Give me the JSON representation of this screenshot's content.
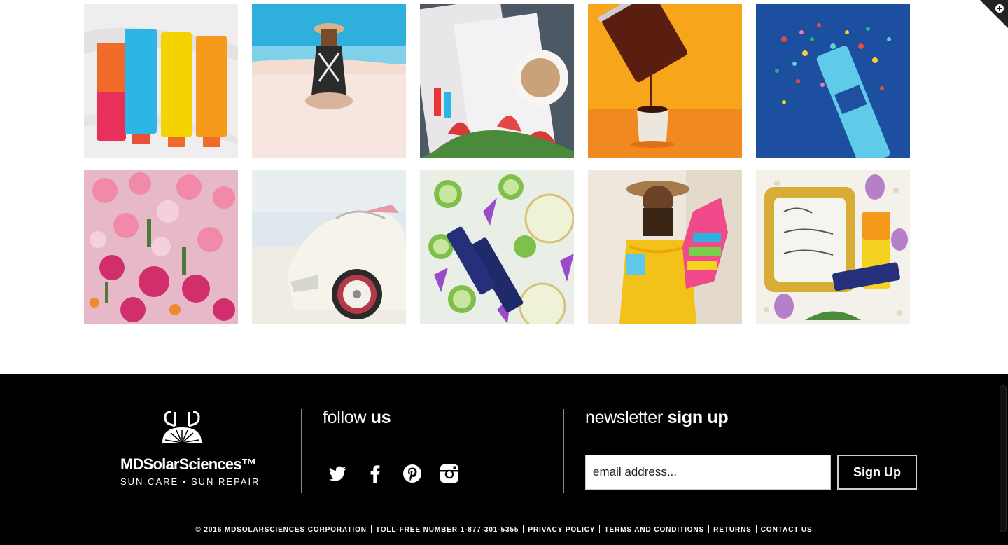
{
  "gallery": {
    "tiles": [
      {
        "subject": "sunscreen tubes on marble",
        "colors": [
          "#f2eeee",
          "#e8305a",
          "#2fb4e8",
          "#f4d400",
          "#f59a1a"
        ]
      },
      {
        "subject": "woman sitting on beach",
        "colors": [
          "#3fb8e0",
          "#f3d9cf",
          "#f8e7e1",
          "#2b2b2b",
          "#d8b48a"
        ]
      },
      {
        "subject": "magazine with coffee and tulips",
        "colors": [
          "#4a5560",
          "#e9e6ea",
          "#c9a27a",
          "#d83a3a",
          "#4b8a3a"
        ]
      },
      {
        "subject": "french press pouring coffee",
        "colors": [
          "#f7a51b",
          "#f08020",
          "#5a1e10",
          "#d6d0c8",
          "#2a1408"
        ]
      },
      {
        "subject": "sunscreen tube with confetti",
        "colors": [
          "#1d4fa0",
          "#e84b3a",
          "#f5d21f",
          "#5fd2d8",
          "#2bb36b"
        ]
      },
      {
        "subject": "pink tulip bouquets",
        "colors": [
          "#e7b8c8",
          "#d02f6c",
          "#f08aa8",
          "#4b7a3a",
          "#f4d0dc"
        ]
      },
      {
        "subject": "vintage white car at beach",
        "colors": [
          "#e9eef0",
          "#dfe6e8",
          "#f2efe8",
          "#8ab0c0",
          "#c6b5a0"
        ]
      },
      {
        "subject": "limes and serum bottles",
        "colors": [
          "#e9efe6",
          "#7fc04a",
          "#9a4cc8",
          "#1f2a6a",
          "#f0f2d8"
        ]
      },
      {
        "subject": "woman with pinata",
        "colors": [
          "#f1ece4",
          "#f2c21a",
          "#5a3a1a",
          "#f04a8a",
          "#2fb0e0"
        ]
      },
      {
        "subject": "mother frame with sunscreen",
        "colors": [
          "#f3f0ea",
          "#d8ad36",
          "#b680c8",
          "#f5d21f",
          "#26307a"
        ]
      }
    ]
  },
  "footer": {
    "brand": {
      "wordmark": "MDSolarSciences™",
      "tagline": "SUN CARE • SUN REPAIR"
    },
    "follow": {
      "heading_light": "follow",
      "heading_bold": "us",
      "icons": [
        "twitter-icon",
        "facebook-icon",
        "pinterest-icon",
        "instagram-icon"
      ]
    },
    "newsletter": {
      "heading_light": "newsletter",
      "heading_bold": "sign up",
      "placeholder": "email address...",
      "value": "",
      "button_label": "Sign Up"
    },
    "legal": {
      "copyright": "© 2016 MDSOLARSCIENCES CORPORATION",
      "phone": "TOLL-FREE NUMBER 1-877-301-5355",
      "links": [
        "PRIVACY POLICY",
        "TERMS AND CONDITIONS",
        "RETURNS",
        "CONTACT US"
      ]
    }
  },
  "colors": {
    "footer_bg": "#000000",
    "page_bg": "#ffffff",
    "text_on_dark": "#ffffff"
  }
}
